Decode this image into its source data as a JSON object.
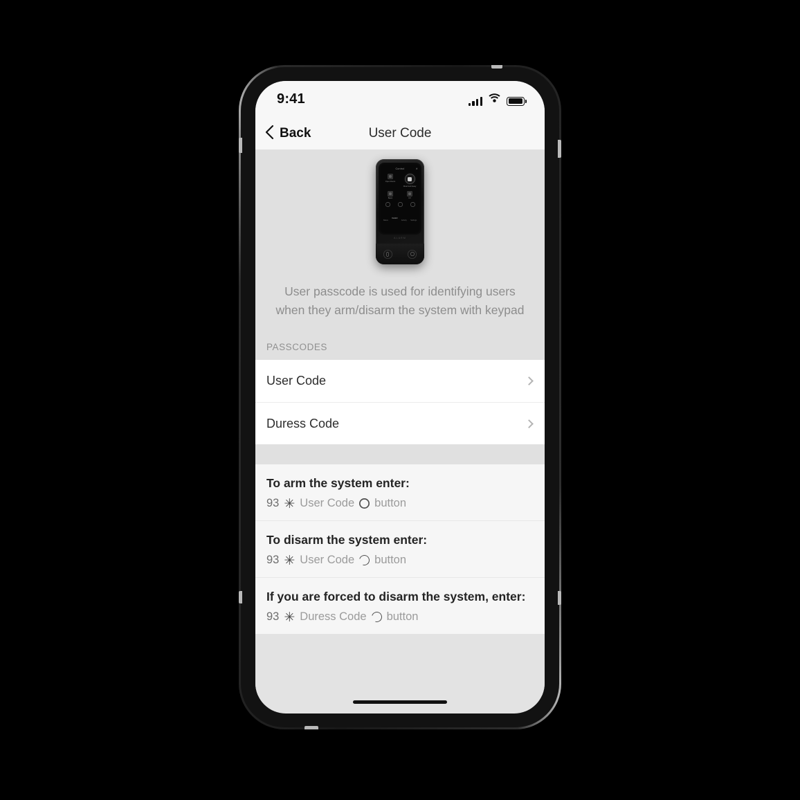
{
  "status_bar": {
    "time": "9:41",
    "icons": [
      "cellular-signal-icon",
      "wifi-icon",
      "battery-icon"
    ],
    "signal_bars": 4,
    "battery_full": true
  },
  "nav_bar": {
    "back_label": "Back",
    "back_icon": "chevron-left-icon",
    "title": "User Code"
  },
  "hero": {
    "device_name": "keypad-device-image",
    "keypad": {
      "header": "Control",
      "close_icon": "close-icon",
      "tiles": [
        {
          "label": "Open Doors",
          "icon": "door-icon"
        },
        {
          "label": "Disarmed Away",
          "icon": "shield-icon"
        },
        {
          "label": "Basic",
          "icon": "panel-icon"
        },
        {
          "label": "UX",
          "icon": "chart-icon"
        }
      ],
      "quick_rings": 3,
      "nav_items": [
        "Status",
        "Control",
        "Activity",
        "Settings"
      ],
      "nav_selected": "Control",
      "brand": "ALARM",
      "hardware_buttons": [
        "fingerprint-button",
        "proximity-button"
      ]
    },
    "description": "User passcode is used for identifying users when they arm/disarm the system with keypad"
  },
  "passcodes_section": {
    "label": "PASSCODES",
    "rows": [
      {
        "label": "User Code",
        "chevron": "chevron-right-icon"
      },
      {
        "label": "Duress Code",
        "chevron": "chevron-right-icon"
      }
    ]
  },
  "instructions": [
    {
      "title": "To arm the system enter:",
      "prefix": "93",
      "star": "✳",
      "code_label": "User Code",
      "glyph": "arm-circle-icon",
      "suffix": "button"
    },
    {
      "title": "To disarm the system enter:",
      "prefix": "93",
      "star": "✳",
      "code_label": "User Code",
      "glyph": "disarm-broken-circle-icon",
      "suffix": "button"
    },
    {
      "title": "If you are forced to disarm the system, enter:",
      "prefix": "93",
      "star": "✳",
      "code_label": "Duress Code",
      "glyph": "disarm-broken-circle-icon",
      "suffix": "button"
    }
  ],
  "colors": {
    "page_bg": "#e0e0e0",
    "bar_bg": "#f7f7f7",
    "list_bg": "#ffffff",
    "instruction_bg": "#f6f6f6",
    "muted_text": "#9b9b9b",
    "title_text": "#242424"
  }
}
